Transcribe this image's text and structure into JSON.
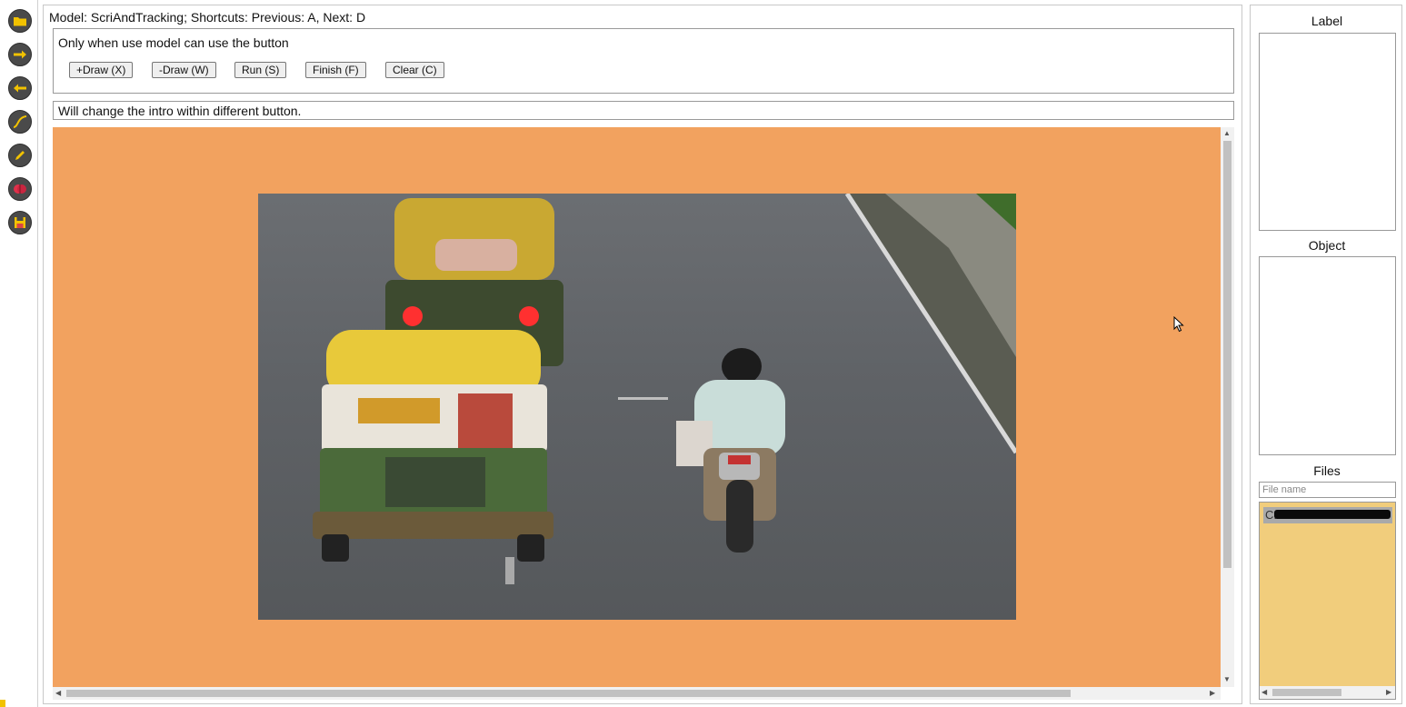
{
  "toolbar": {
    "tools": [
      {
        "icon": "folder-icon",
        "color": "#f2c200"
      },
      {
        "icon": "arrow-right-icon",
        "color": "#f2c200"
      },
      {
        "icon": "arrow-left-icon",
        "color": "#f2c200"
      },
      {
        "icon": "curve-icon",
        "color": "#f2c200"
      },
      {
        "icon": "pencil-icon",
        "color": "#f2c200"
      },
      {
        "icon": "brain-icon",
        "color": "#e0304a"
      },
      {
        "icon": "save-icon",
        "color": "#f2c200"
      }
    ]
  },
  "main": {
    "model_line": "Model: ScriAndTracking; Shortcuts: Previous: A, Next: D",
    "button_group_title": "Only when use model can use the button",
    "buttons": {
      "add_draw": "+Draw (X)",
      "remove_draw": "-Draw (W)",
      "run": "Run (S)",
      "finish": "Finish (F)",
      "clear": "Clear (C)"
    },
    "intro": "Will change the intro within different button."
  },
  "side": {
    "label_title": "Label",
    "object_title": "Object",
    "files_title": "Files",
    "file_input_placeholder": "File name",
    "file_item": "C:"
  },
  "colors": {
    "canvas_bg": "#f2a25f",
    "file_list_bg": "#f1cd7c",
    "icon_bg": "#4a4a4a"
  }
}
